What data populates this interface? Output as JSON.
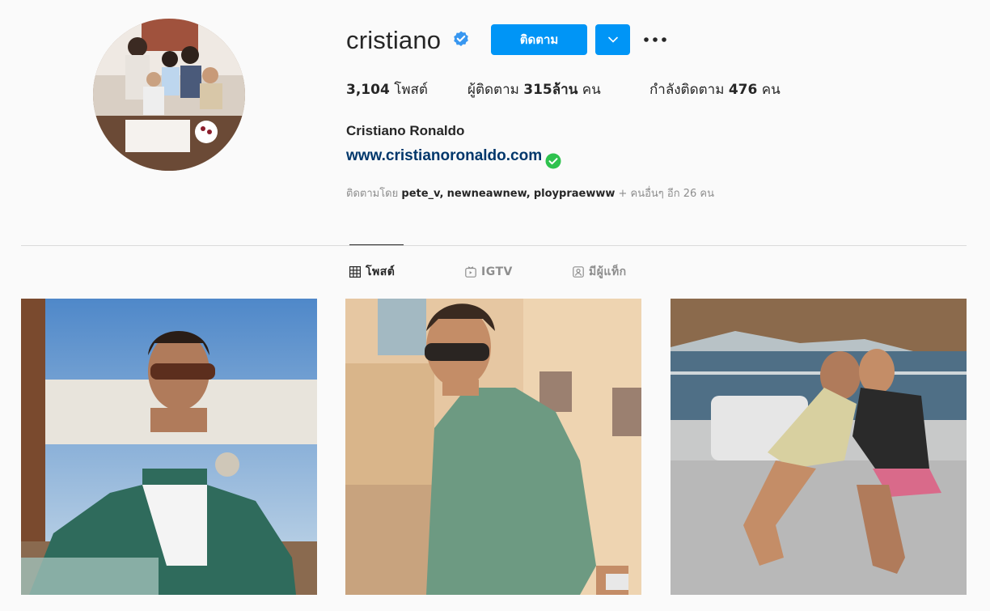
{
  "profile": {
    "username": "cristiano",
    "full_name": "Cristiano Ronaldo",
    "website": "www.cristianoronaldo.com",
    "follow_label": "ติดตาม"
  },
  "stats": {
    "posts_count": "3,104",
    "posts_label": "โพสต์",
    "followers_prefix": "ผู้ติดตาม",
    "followers_count": "315ล้าน",
    "followers_suffix": "คน",
    "following_prefix": "กำลังติดตาม",
    "following_count": "476",
    "following_suffix": "คน"
  },
  "followed_by": {
    "prefix": "ติดตามโดย",
    "users": [
      "pete_v",
      "newneawnew",
      "ploypraewww"
    ],
    "suffix": "+ คนอื่นๆ อีก 26 คน"
  },
  "tabs": [
    {
      "label": "โพสต์",
      "icon": "grid-icon",
      "active": true
    },
    {
      "label": "IGTV",
      "icon": "igtv-icon",
      "active": false
    },
    {
      "label": "มีผู้แท็ก",
      "icon": "tagged-icon",
      "active": false
    }
  ],
  "colors": {
    "accent": "#0095f6",
    "verified": "#3897f0",
    "link": "#00376b",
    "site_check": "#2ec24e",
    "background": "#fafafa"
  }
}
